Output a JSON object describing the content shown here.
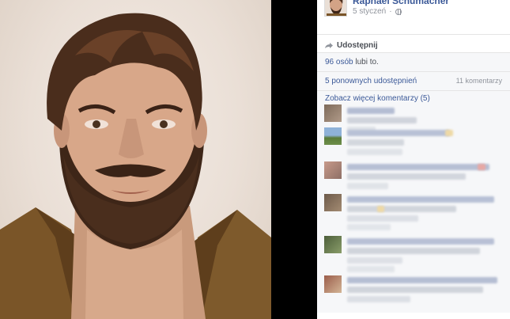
{
  "post": {
    "author_name": "Raphael Schumacher",
    "date": "5 styczeń",
    "menu_chevron": "▾",
    "privacy_icon": "globe-icon"
  },
  "actions": {
    "share_label": "Udostępnij",
    "share_icon": "share-arrow-icon"
  },
  "stats": {
    "likes_count": "96 osób",
    "likes_suffix": "lubi to.",
    "shares": "5 ponownych udostępnień",
    "comments": "11 komentarzy",
    "see_more": "Zobacz więcej komentarzy (5)"
  },
  "colors": {
    "link": "#3b5998",
    "muted": "#90949c",
    "panel_bg": "#f6f7f9",
    "viewer_bg": "#000000"
  }
}
